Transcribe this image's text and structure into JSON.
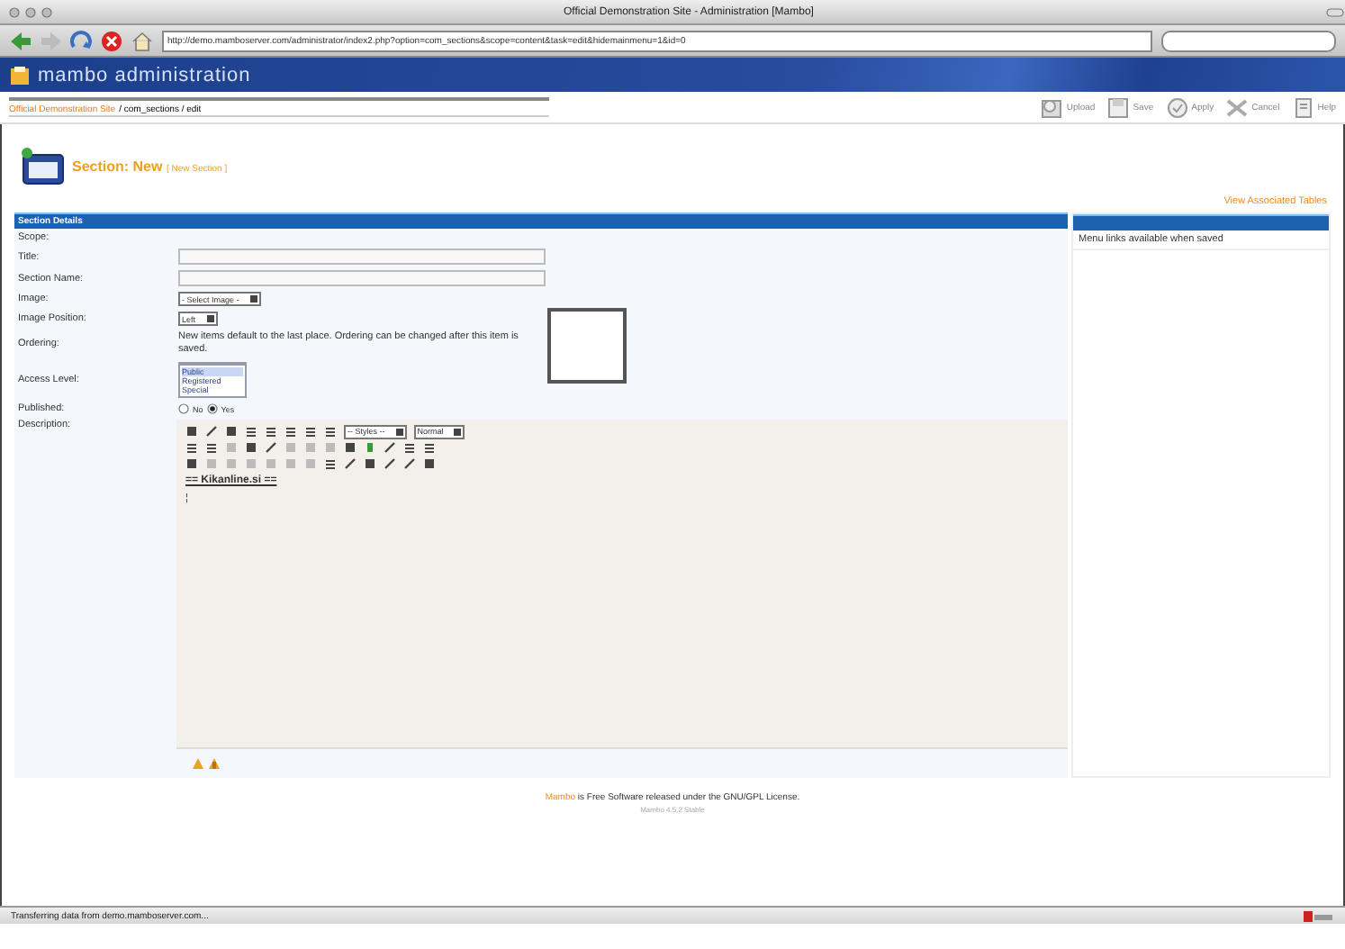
{
  "browser": {
    "title": "Official Demonstration Site - Administration [Mambo]",
    "url": "http://demo.mamboserver.com/administrator/index2.php?option=com_sections&scope=content&task=edit&hidemainmenu=1&id=0",
    "status": "Transferring data from demo.mamboserver.com..."
  },
  "header": {
    "logo_text": "mambo administration"
  },
  "pathway": [
    {
      "label": "Official Demonstration Site",
      "kind": "link"
    },
    {
      "label": "/ com_sections / edit",
      "kind": "text"
    }
  ],
  "toolbar": [
    {
      "label": "Upload",
      "kind": "upload"
    },
    {
      "label": "Save",
      "kind": "save"
    },
    {
      "label": "Apply",
      "kind": "apply"
    },
    {
      "label": "Cancel",
      "kind": "cancel"
    },
    {
      "label": "Help",
      "kind": "help"
    }
  ],
  "page_title": {
    "main": "Section: New",
    "sub": "[ New Section ]"
  },
  "tables_link": "View Associated Tables",
  "form": {
    "heading": "Section Details",
    "fields": [
      {
        "kind": "plain",
        "label": "Scope:"
      },
      {
        "kind": "text",
        "label": "Title:"
      },
      {
        "kind": "text",
        "label": "Section Name:"
      },
      {
        "kind": "select",
        "label": "Image:",
        "value": "- Select Image -"
      },
      {
        "kind": "select",
        "label": "Image Position:",
        "value": "Left"
      },
      {
        "kind": "note",
        "label": "Ordering:",
        "value": "New items default to the last place. Ordering can be changed after this item is saved."
      },
      {
        "kind": "listbox",
        "label": "Access Level:",
        "options": [
          {
            "label": "Public",
            "selected": true
          },
          {
            "label": "Registered",
            "selected": false
          },
          {
            "label": "Special",
            "selected": false
          }
        ]
      },
      {
        "kind": "radio",
        "label": "Published:",
        "options": [
          {
            "label": "No",
            "selected": false
          },
          {
            "label": "Yes",
            "selected": true
          }
        ]
      },
      {
        "kind": "editor",
        "label": "Description:"
      }
    ]
  },
  "editor": {
    "style_select": "-- Styles --",
    "format_select": "Normal",
    "content": "== Kikanline.si ==",
    "cursor": "¦"
  },
  "side_panel": {
    "note": "Menu links available when saved"
  },
  "footer": {
    "brand": "Mambo",
    "text": " is Free Software released under the GNU/GPL License.",
    "version": "Mambo 4.5.2 Stable"
  }
}
